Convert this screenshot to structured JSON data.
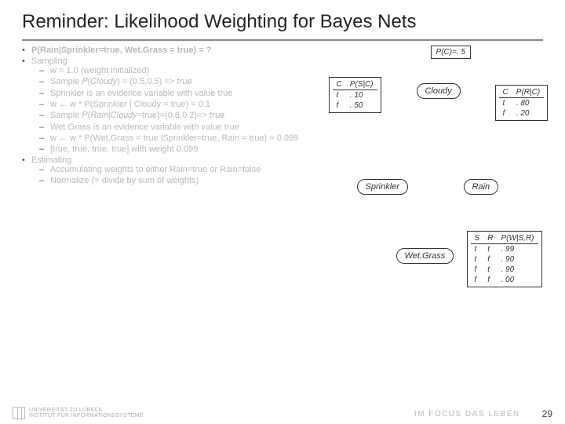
{
  "title": "Reminder: Likelihood Weighting for Bayes Nets",
  "left": {
    "l0_label": "",
    "l0_formula": "P(Rain|Sprinkler=true, Wet.Grass = true) = ?",
    "l1": "Sampling",
    "s1": "w = 1.0  (weight initialized)",
    "s2": "Sample 𝑃(𝐶𝑙𝑜𝑢𝑑𝑦) = (0.5,0.5)  => 𝑡𝑟𝑢𝑒",
    "s3": "Sprinkler is an evidence variable with value true",
    "s4": "w ← w * P(Sprinkler | Cloudy = true) = 0.1",
    "s5": "Sample 𝑃(𝑅𝑎𝑖𝑛|𝐶𝑙𝑜𝑢𝑑𝑦=true)=(0.8,0.2)=> 𝑡𝑟𝑢𝑒",
    "s6": "Wet.Grass is an evidence variable with value true",
    "s7": "w ← w * P(Wet.Grass = true |Sprinkler=true, Rain = true) = 0.099",
    "s8": "[true, true, true, true] with weight 0.099",
    "l2": "Estimating",
    "e1": "Accumulating weights to either Rain=true or Rain=false",
    "e2": "Normalize (= divide by sum of weights)"
  },
  "net": {
    "prior": {
      "header": "P(C)=. 5"
    },
    "cloudy": "Cloudy",
    "sprinkler": "Sprinkler",
    "rain": "Rain",
    "wetgrass": "Wet.Grass",
    "psc": {
      "hC": "C",
      "hP": "P(S|C)",
      "r1c": "t",
      "r1p": ". 10",
      "r2c": "f",
      "r2p": ". 50"
    },
    "prc": {
      "hC": "C",
      "hP": "P(R|C)",
      "r1c": "t",
      "r1p": ". 80",
      "r2c": "f",
      "r2p": ". 20"
    },
    "pwsr": {
      "hS": "S",
      "hR": "R",
      "hP": "P(W|S,R)",
      "r1s": "t",
      "r1r": "t",
      "r1p": ". 99",
      "r2s": "t",
      "r2r": "f",
      "r2p": ". 90",
      "r3s": "f",
      "r3r": "t",
      "r3p": ". 90",
      "r4s": "f",
      "r4r": "f",
      "r4p": ". 00"
    }
  },
  "footer": {
    "logo1": "UNIVERSITÄT ZU LÜBECK",
    "logo2": "INSTITUT FÜR INFORMATIONSSYSTEME",
    "tagline": "IM FOCUS DAS LEBEN",
    "page": "29"
  },
  "chart_data": {
    "type": "bayes-net",
    "nodes": [
      "Cloudy",
      "Sprinkler",
      "Rain",
      "Wet.Grass"
    ],
    "edges": [
      [
        "Cloudy",
        "Sprinkler"
      ],
      [
        "Cloudy",
        "Rain"
      ],
      [
        "Sprinkler",
        "Wet.Grass"
      ],
      [
        "Rain",
        "Wet.Grass"
      ]
    ],
    "P(C)": 0.5,
    "P(S|C)": {
      "t": 0.1,
      "f": 0.5
    },
    "P(R|C)": {
      "t": 0.8,
      "f": 0.2
    },
    "P(W|S,R)": {
      "t,t": 0.99,
      "t,f": 0.9,
      "f,t": 0.9,
      "f,f": 0.0
    }
  }
}
